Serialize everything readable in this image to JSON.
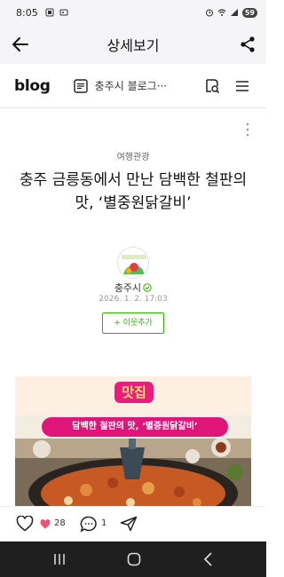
{
  "status_bar": {
    "time": "8:05",
    "battery": "59"
  },
  "app_bar": {
    "title": "상세보기",
    "back_icon": "arrow-left-icon",
    "share_icon": "share-icon"
  },
  "blog_bar": {
    "logo": "blog",
    "blog_name": "충주시 블로그···",
    "search_icon": "search-icon",
    "menu_icon": "hamburger-menu-icon"
  },
  "article": {
    "category": "여행관광",
    "title": "충주 금릉동에서 만난 담백한 철판의 맛, ‘별중원닭갈비’",
    "author": "충주시",
    "date": "2026. 1. 2. 17:03",
    "follow_label": "+ 이웃추가"
  },
  "post_image": {
    "badge": "맛집",
    "banner": "담백한 철판의 맛, ‘별중원닭갈비’"
  },
  "action_bar": {
    "like_count": "28",
    "comment_count": "1"
  },
  "colors": {
    "accent_green": "#2db400",
    "banner_pink": "#e0157a",
    "like_pink": "#f2527a"
  }
}
